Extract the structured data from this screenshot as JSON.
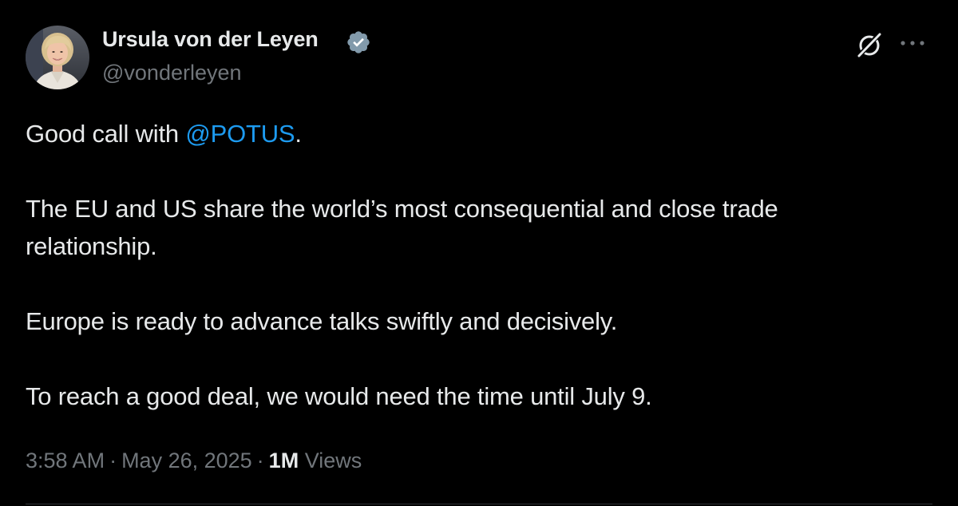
{
  "author": {
    "display_name": "Ursula von der Leyen",
    "handle": "@vonderleyen",
    "verified": true,
    "avatar_icon": "profile-photo"
  },
  "icons": {
    "verified": "verified-badge-icon",
    "grok": "grok-icon",
    "more": "more-options-icon"
  },
  "colors": {
    "background": "#000000",
    "text": "#e7e9ea",
    "secondary_text": "#71767b",
    "link": "#1d9bf0",
    "verified_badge": "#829aab"
  },
  "tweet": {
    "line1_prefix": "Good call with ",
    "mention": "@POTUS",
    "line1_suffix": ".",
    "paragraph2": "The EU and US share the world’s most consequential and close trade relationship.",
    "paragraph3": "Europe is ready to advance talks swiftly and decisively.",
    "paragraph4": "To reach a good deal, we would need the time until July 9."
  },
  "meta": {
    "time": "3:58 AM",
    "separator": "·",
    "date": "May 26, 2025",
    "views_count": "1M",
    "views_label": "Views"
  }
}
